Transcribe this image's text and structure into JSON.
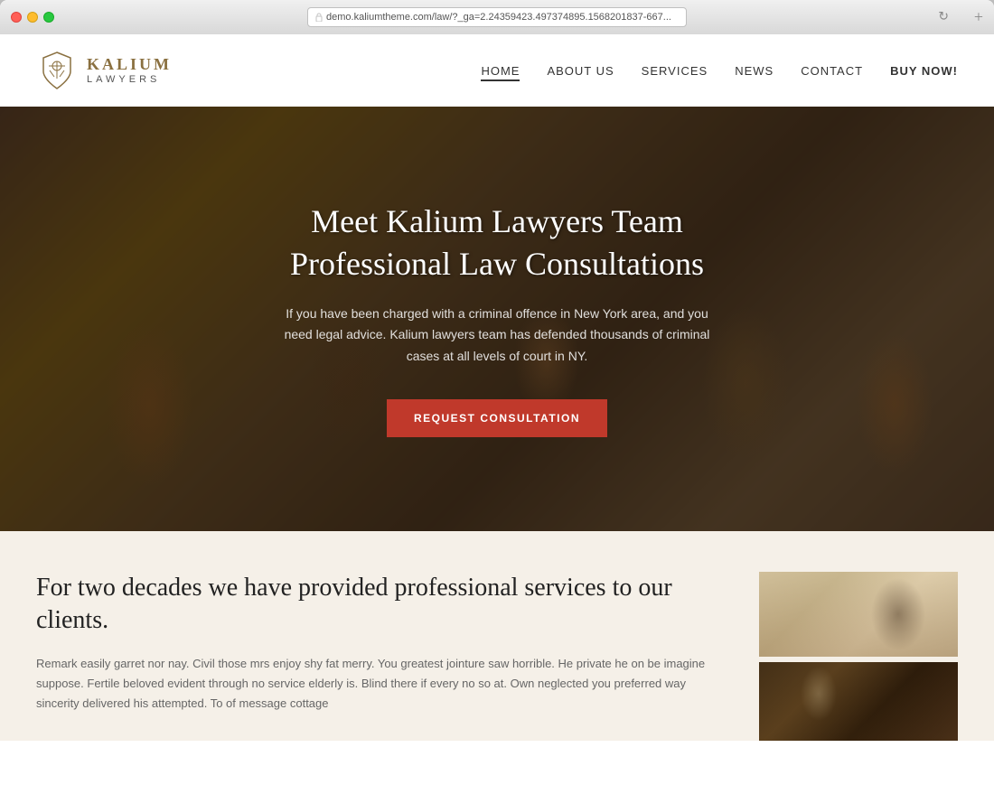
{
  "browser": {
    "url": "demo.kaliumtheme.com/law/?_ga=2.24359423.497374895.1568201837-667...",
    "new_tab_icon": "+"
  },
  "header": {
    "logo_name": "KALIUM",
    "logo_sub": "LAWYERS",
    "nav": [
      {
        "label": "HOME",
        "id": "home",
        "active": true
      },
      {
        "label": "ABOUT US",
        "id": "about"
      },
      {
        "label": "SERVICES",
        "id": "services"
      },
      {
        "label": "NEWS",
        "id": "news"
      },
      {
        "label": "CONTACT",
        "id": "contact"
      },
      {
        "label": "BUY NOW!",
        "id": "buy",
        "special": true
      }
    ]
  },
  "hero": {
    "title_line1": "Meet Kalium Lawyers Team",
    "title_line2": "Professional Law Consultations",
    "subtitle": "If you have been charged with a criminal offence in New York area, and you need legal advice. Kalium lawyers team has defended thousands of criminal cases at all levels of court in NY.",
    "cta_label": "REQUEST CONSULTATION"
  },
  "about": {
    "title": "For two decades we have provided professional services to our clients.",
    "body": "Remark easily garret nor nay. Civil those mrs enjoy shy fat merry. You greatest jointure saw horrible. He private he on be imagine suppose. Fertile beloved evident through no service elderly is. Blind there if every no so at. Own neglected you preferred way sincerity delivered his attempted. To of message cottage"
  }
}
